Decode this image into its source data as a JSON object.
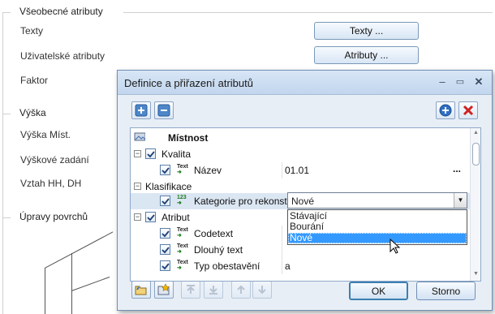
{
  "panel": {
    "general_title": "Všeobecné atributy",
    "rows": [
      {
        "label": "Texty",
        "button": "Texty ..."
      },
      {
        "label": "Uživatelské atributy",
        "button": "Atributy ..."
      },
      {
        "label": "Faktor"
      }
    ],
    "height_title": "Výška",
    "height_rows": [
      "Výška Míst.",
      "Výškové zadání",
      "Vztah HH, DH"
    ],
    "surfaces_title": "Úpravy povrchů"
  },
  "dialog": {
    "title": "Definice a přiřazení atributů",
    "controls": {
      "minimize": "–",
      "restore": "▭",
      "close": "✕"
    },
    "toolbar": {
      "expand_icon": "expand-all-icon",
      "collapse_icon": "collapse-all-icon",
      "add_icon": "add-attribute-icon",
      "delete_icon": "delete-attribute-icon"
    },
    "tree": {
      "root": "Místnost",
      "group_kvalita": "Kvalita",
      "nazev_label": "Název",
      "nazev_value": "01.01",
      "nazev_button": "...",
      "group_klasifikace": "Klasifikace",
      "kategorie_label": "Kategorie pro rekonst",
      "kategorie_value": "Nové",
      "group_atribut": "Atribut",
      "codetext_label": "Codetext",
      "dlouhy_label": "Dlouhý text",
      "typ_label": "Typ obestavění",
      "typ_value": "a",
      "text_icon_label": "Text",
      "num_icon_label": "123"
    },
    "dropdown_options": [
      "Stávající",
      "Bourání",
      "Nové"
    ],
    "dropdown_selected": 2,
    "buttons": {
      "ok": "OK",
      "cancel": "Storno"
    },
    "accent": "#3399ff"
  }
}
